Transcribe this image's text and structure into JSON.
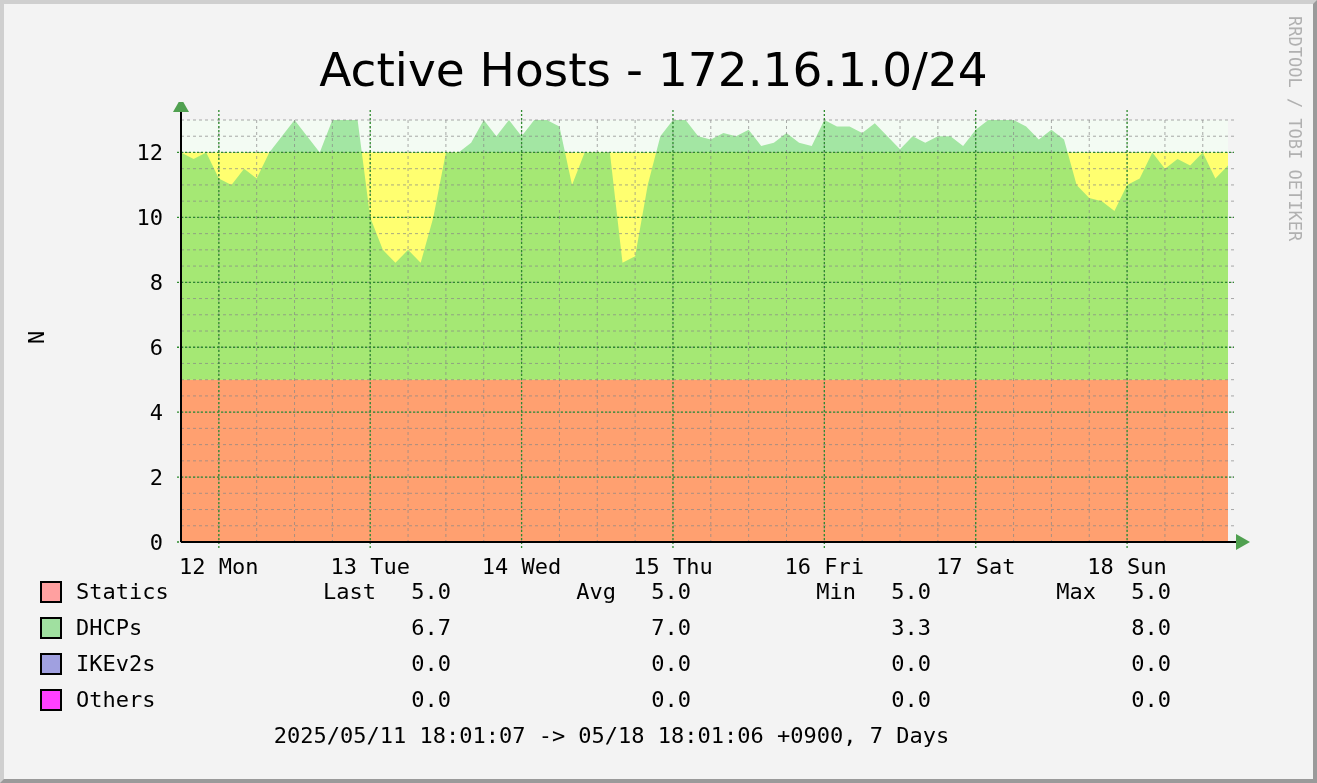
{
  "title": "Active Hosts - 172.16.1.0/24",
  "credit": "RRDTOOL / TOBI OETIKER",
  "chart_data": {
    "type": "area",
    "stacked": true,
    "grid": true,
    "ylabel": "N",
    "ylim": [
      0,
      13
    ],
    "yticks": [
      0,
      2,
      4,
      6,
      8,
      10,
      12
    ],
    "categories": [
      null,
      null,
      null,
      "12 Mon",
      null,
      null,
      null,
      null,
      null,
      null,
      null,
      null,
      null,
      null,
      null,
      "13 Tue",
      null,
      null,
      null,
      null,
      null,
      null,
      null,
      null,
      null,
      null,
      null,
      "14 Wed",
      null,
      null,
      null,
      null,
      null,
      null,
      null,
      null,
      null,
      null,
      null,
      "15 Thu",
      null,
      null,
      null,
      null,
      null,
      null,
      null,
      null,
      null,
      null,
      null,
      "16 Fri",
      null,
      null,
      null,
      null,
      null,
      null,
      null,
      null,
      null,
      null,
      null,
      "17 Sat",
      null,
      null,
      null,
      null,
      null,
      null,
      null,
      null,
      null,
      null,
      null,
      "18 Sun",
      null,
      null,
      null,
      null,
      null,
      null,
      null,
      null
    ],
    "series": [
      {
        "name": "Statics",
        "color": "#ffa070",
        "values": [
          5,
          5,
          5,
          5,
          5,
          5,
          5,
          5,
          5,
          5,
          5,
          5,
          5,
          5,
          5,
          5,
          5,
          5,
          5,
          5,
          5,
          5,
          5,
          5,
          5,
          5,
          5,
          5,
          5,
          5,
          5,
          5,
          5,
          5,
          5,
          5,
          5,
          5,
          5,
          5,
          5,
          5,
          5,
          5,
          5,
          5,
          5,
          5,
          5,
          5,
          5,
          5,
          5,
          5,
          5,
          5,
          5,
          5,
          5,
          5,
          5,
          5,
          5,
          5,
          5,
          5,
          5,
          5,
          5,
          5,
          5,
          5,
          5,
          5,
          5,
          5,
          5,
          5,
          5,
          5,
          5,
          5,
          5,
          5
        ]
      },
      {
        "name": "DHCPs",
        "color": "#a5e874",
        "values": [
          7,
          6.8,
          7,
          6.2,
          6,
          6.5,
          6.2,
          7,
          7.5,
          8,
          7.5,
          7,
          8,
          8,
          8,
          5,
          4,
          3.6,
          4,
          3.6,
          5,
          7,
          7,
          7.3,
          8,
          7.5,
          8,
          7.5,
          8,
          8,
          7.8,
          6,
          7,
          7,
          7,
          3.6,
          3.8,
          6,
          7.5,
          8,
          8,
          7.5,
          7.4,
          7.6,
          7.5,
          7.7,
          7.2,
          7.3,
          7.6,
          7.3,
          7.2,
          8,
          7.8,
          7.8,
          7.6,
          7.9,
          7.5,
          7.1,
          7.5,
          7.3,
          7.5,
          7.5,
          7.2,
          7.7,
          8,
          8,
          8,
          7.8,
          7.4,
          7.7,
          7.4,
          6,
          5.6,
          5.5,
          5.2,
          6,
          6.2,
          7,
          6.5,
          6.8,
          6.6,
          7,
          6.2,
          6.6
        ]
      }
    ]
  },
  "legend": {
    "columns": [
      "Last",
      "Avg",
      "Min",
      "Max"
    ],
    "items": [
      {
        "color": "#ffa0a0",
        "values": [
          "5.0",
          "5.0",
          "5.0",
          "5.0"
        ]
      },
      {
        "color": "#a0e0a0",
        "values": [
          "6.7",
          "7.0",
          "3.3",
          "8.0"
        ]
      },
      {
        "name": "IKEv2s",
        "color": "#a0a0e0",
        "values": [
          "0.0",
          "0.0",
          "0.0",
          "0.0"
        ]
      },
      {
        "name": "Others",
        "color": "#ff40ff",
        "values": [
          "0.0",
          "0.0",
          "0.0",
          "0.0"
        ]
      }
    ]
  },
  "period": "2025/05/11 18:01:07 -> 05/18 18:01:06 +0900, 7 Days"
}
